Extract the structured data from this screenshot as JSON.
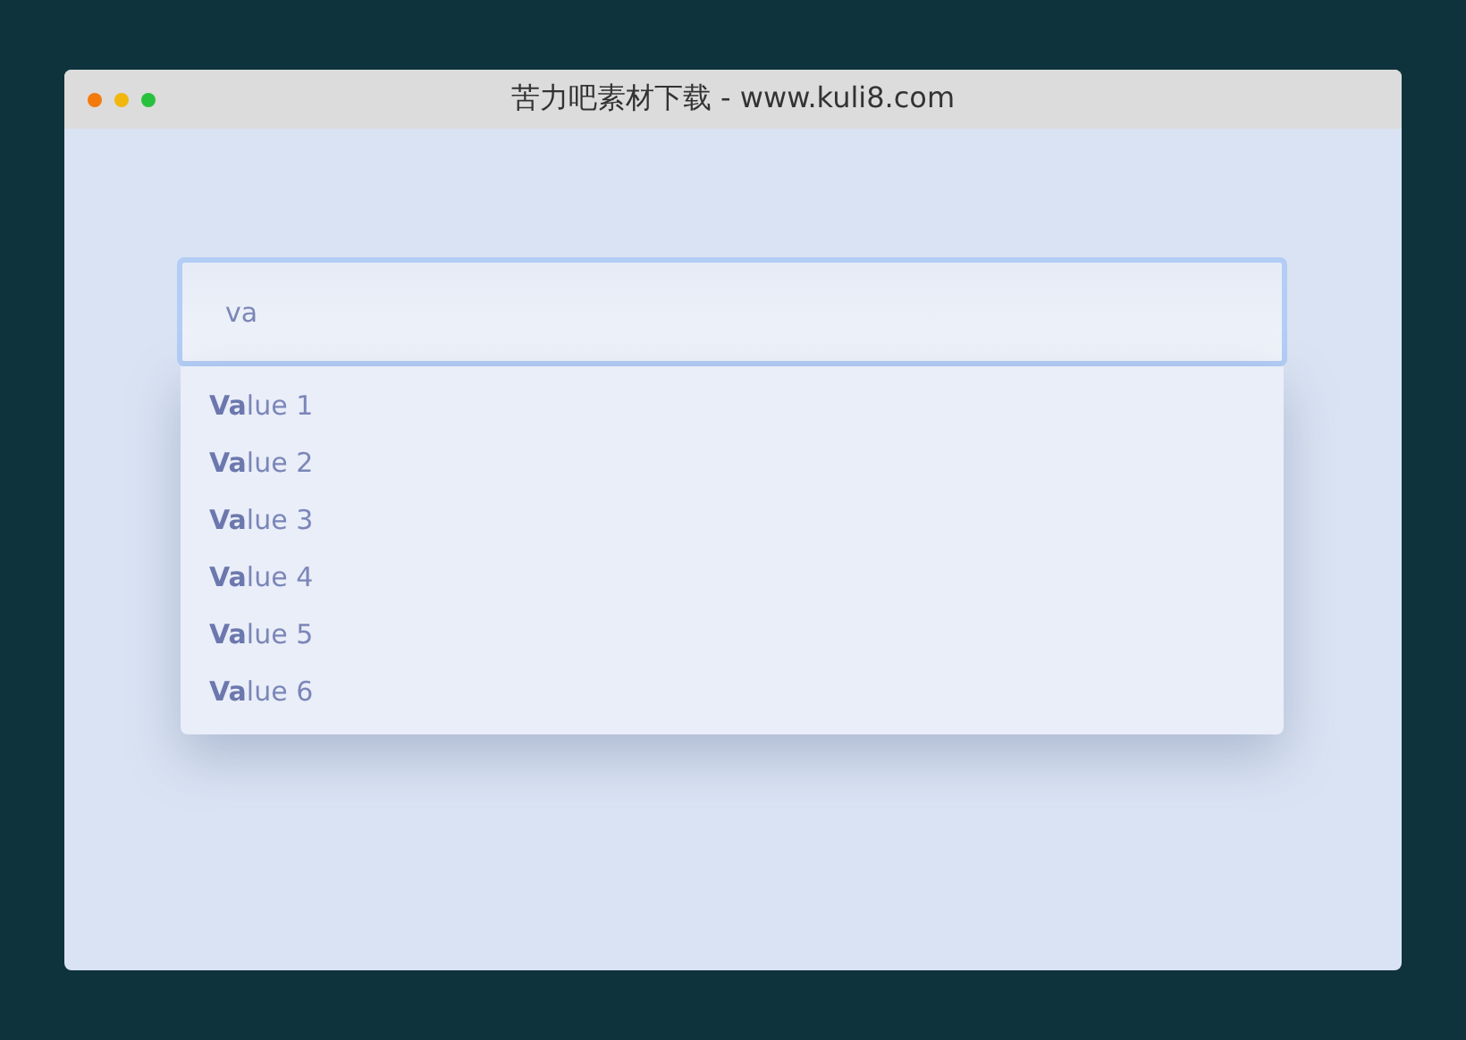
{
  "window": {
    "title": "苦力吧素材下载 - www.kuli8.com"
  },
  "search": {
    "value": "va"
  },
  "suggestions": [
    {
      "label": "**Va**lue 1"
    },
    {
      "label": "**Va**lue 2"
    },
    {
      "label": "**Va**lue 3"
    },
    {
      "label": "**Va**lue 4"
    },
    {
      "label": "**Va**lue 5"
    },
    {
      "label": "**Va**lue 6"
    }
  ]
}
